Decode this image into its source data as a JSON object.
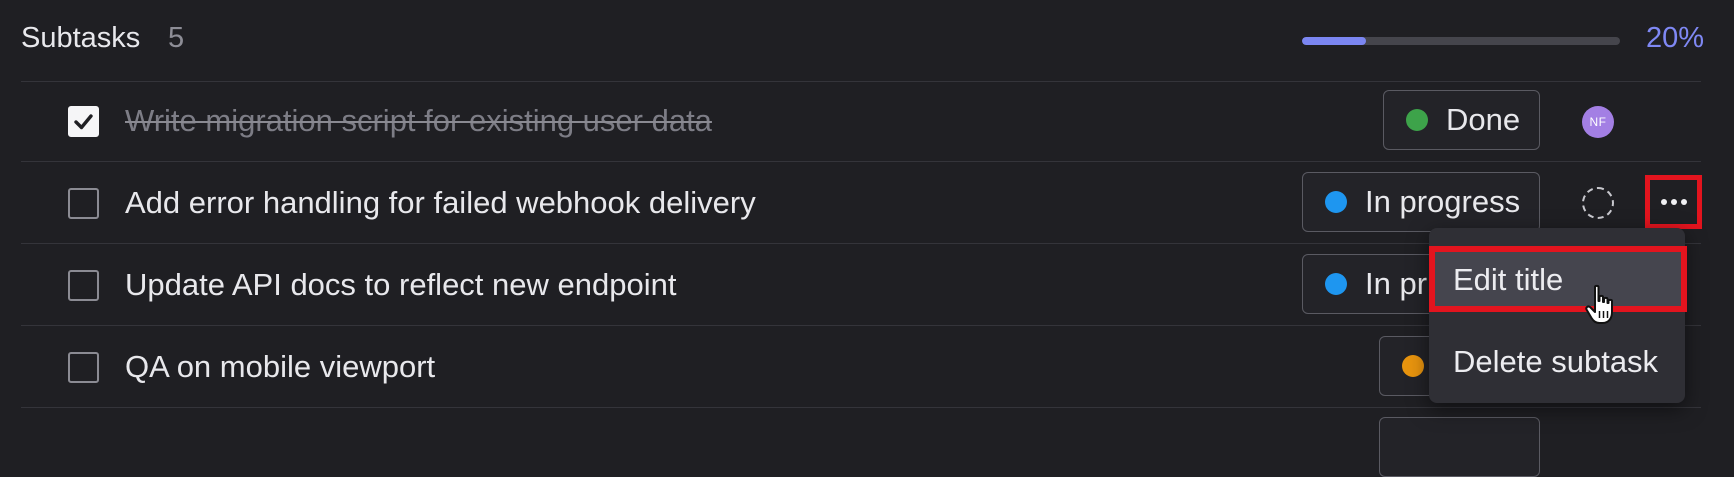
{
  "header": {
    "title": "Subtasks",
    "count": "5",
    "progress": 0.2,
    "percent_label": "20%"
  },
  "colors": {
    "accent": "#7b86f2",
    "done": "#3da34a",
    "in_progress": "#1e96f0",
    "pending": "#e8940e",
    "highlight": "#e3141e",
    "avatar_bg": "#a37fe4"
  },
  "subtasks": [
    {
      "title": "Write migration script for existing user data",
      "checked": true,
      "status": "Done",
      "assignee": "NF"
    },
    {
      "title": "Add error handling for failed webhook delivery",
      "checked": false,
      "status": "In progress",
      "assignee": ""
    },
    {
      "title": "Update API docs to reflect new endpoint",
      "checked": false,
      "status": "In progress",
      "assignee": ""
    },
    {
      "title": "QA on mobile viewport",
      "checked": false,
      "status": "",
      "assignee": ""
    }
  ],
  "row2_status_visible": "In pr",
  "menu": {
    "items": [
      {
        "label": "Edit title"
      },
      {
        "label": "Delete subtask"
      }
    ]
  },
  "icons": {
    "more": "more-horizontal-icon",
    "check": "check-icon",
    "cursor": "hand-pointer-icon"
  }
}
